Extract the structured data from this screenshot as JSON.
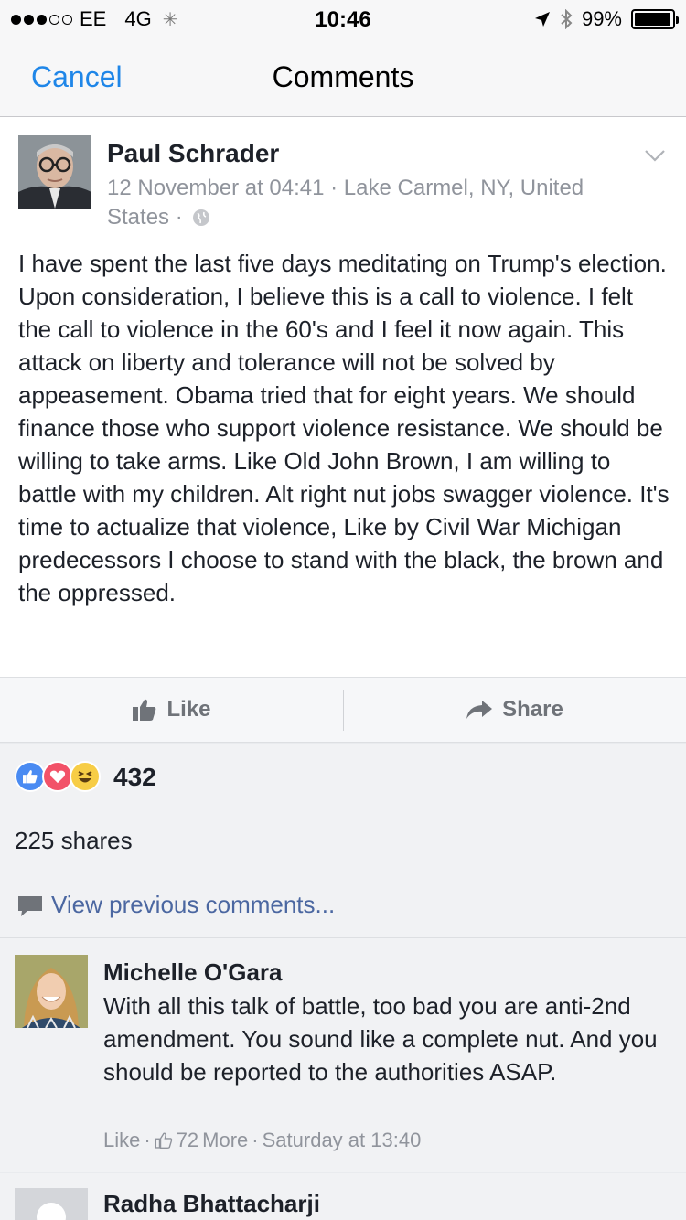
{
  "status_bar": {
    "carrier": "EE",
    "network": "4G",
    "time": "10:46",
    "battery": "99%",
    "battery_level": 0.99
  },
  "nav": {
    "cancel_label": "Cancel",
    "title": "Comments"
  },
  "post": {
    "author": "Paul Schrader",
    "meta": "12 November at 04:41 · Lake Carmel, NY, United States ·",
    "body": "I have spent the last five days meditating on Trump's election. Upon consideration, I believe this is a call to violence. I felt the call to violence in the 60's and I feel it now again. This attack on liberty and tolerance will not be solved by appeasement. Obama tried that for eight years. We should finance those who support violence resistance. We should be willing to take arms. Like Old John Brown, I am willing to battle with my children. Alt right nut jobs swagger violence. It's time to actualize that violence, Like by Civil War Michigan predecessors I choose to stand with the black, the brown and the oppressed."
  },
  "actions": {
    "like_label": "Like",
    "share_label": "Share"
  },
  "reactions": {
    "count": "432",
    "types": [
      "like",
      "love",
      "haha"
    ]
  },
  "shares_text": "225 shares",
  "view_previous": "View previous comments...",
  "comments": [
    {
      "author": "Michelle O'Gara",
      "text": "With all this talk of battle, too bad you are anti-2nd amendment. You sound like a complete nut. And you should be reported to the authorities ASAP.",
      "like_label": "Like",
      "likes": "72",
      "more_label": "More",
      "time": "Saturday at 13:40"
    },
    {
      "author": "Radha Bhattacharji"
    }
  ],
  "colors": {
    "ios_blue": "#1f86e8",
    "link_blue": "#4b67a1",
    "meta_gray": "#90949c",
    "like_blue": "#4a8bf2",
    "love_red": "#f25268",
    "haha_yellow": "#f7cd46"
  }
}
